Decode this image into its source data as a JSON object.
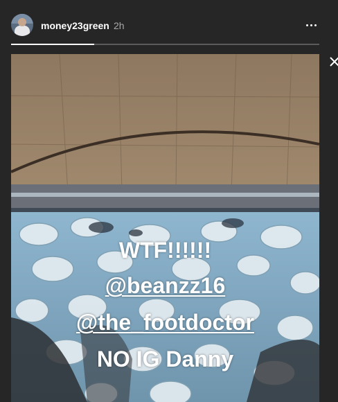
{
  "story": {
    "username": "money23green",
    "time": "2h",
    "progress": 0.27,
    "captions": [
      "WTF!!!!!!",
      "@beanzz16",
      "@the_footdoctor",
      "NO IG Danny"
    ],
    "icons": {
      "avatar": "profile-avatar",
      "more": "more-options-icon",
      "close": "close-icon"
    }
  }
}
